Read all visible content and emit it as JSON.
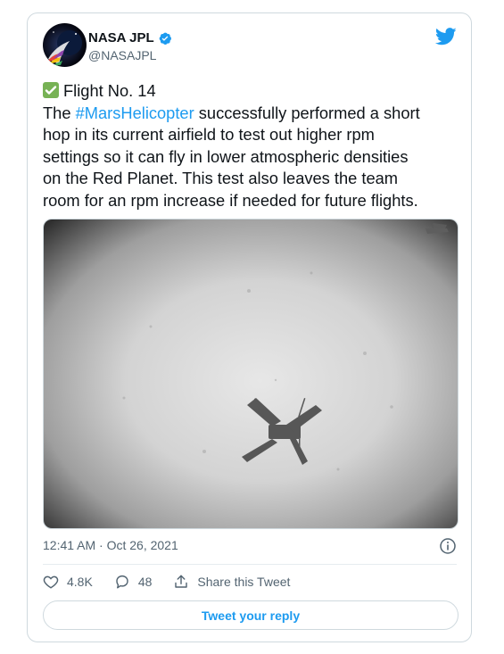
{
  "author": {
    "name": "NASA JPL",
    "handle": "@NASAJPL"
  },
  "tweet": {
    "emoji_icon": "check-mark-button-emoji",
    "headline": "Flight No. 14",
    "text_before_hashtag": "The ",
    "hashtag": "#MarsHelicopter",
    "text_after_hashtag": " successfully performed a short",
    "line_2": "hop in its current airfield to test out higher rpm",
    "line_3": "settings so it can fly in lower atmospheric densities",
    "line_4": "on the Red Planet. This test also leaves the team",
    "line_5": "room for an rpm increase if needed for future flights."
  },
  "timestamp": "12:41 AM · Oct 26, 2021",
  "actions": {
    "like_count": "4.8K",
    "reply_count": "48",
    "share_label": "Share this Tweet"
  },
  "reply_button_label": "Tweet your reply",
  "colors": {
    "accent": "#1d9bf0",
    "text": "#0f1419",
    "muted": "#536471",
    "check_green": "#77b255"
  }
}
